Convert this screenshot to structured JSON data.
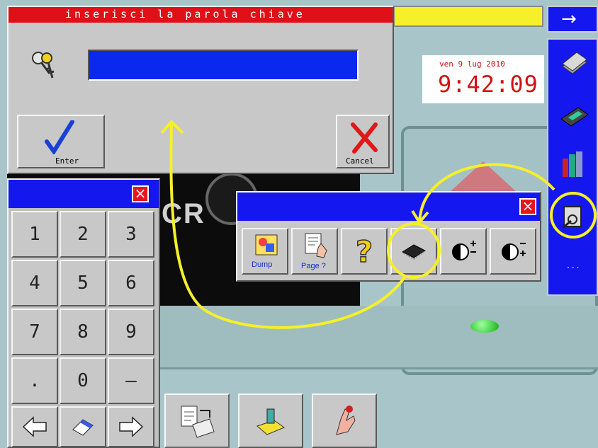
{
  "password_dialog": {
    "title": "inserisci la parola chiave",
    "enter_label": "Enter",
    "cancel_label": "Cancel"
  },
  "clock": {
    "date": "ven  9 lug 2010",
    "time": "9:42:09"
  },
  "keypad": {
    "keys": [
      "1",
      "2",
      "3",
      "4",
      "5",
      "6",
      "7",
      "8",
      "9",
      ".",
      "0",
      "–"
    ]
  },
  "tool_popup": {
    "dump_label": "Dump",
    "page_label": "Page ?",
    "help_glyph": "?"
  },
  "side_toolbar": {
    "arrow_glyph": "→",
    "more_label": "..."
  },
  "logo": {
    "text": "CR"
  },
  "colors": {
    "title_red": "#e01018",
    "panel_blue": "#1518ee",
    "field_blue": "#0a28ee",
    "highlight_yellow": "#f6f02a",
    "clock_red": "#d41010"
  }
}
